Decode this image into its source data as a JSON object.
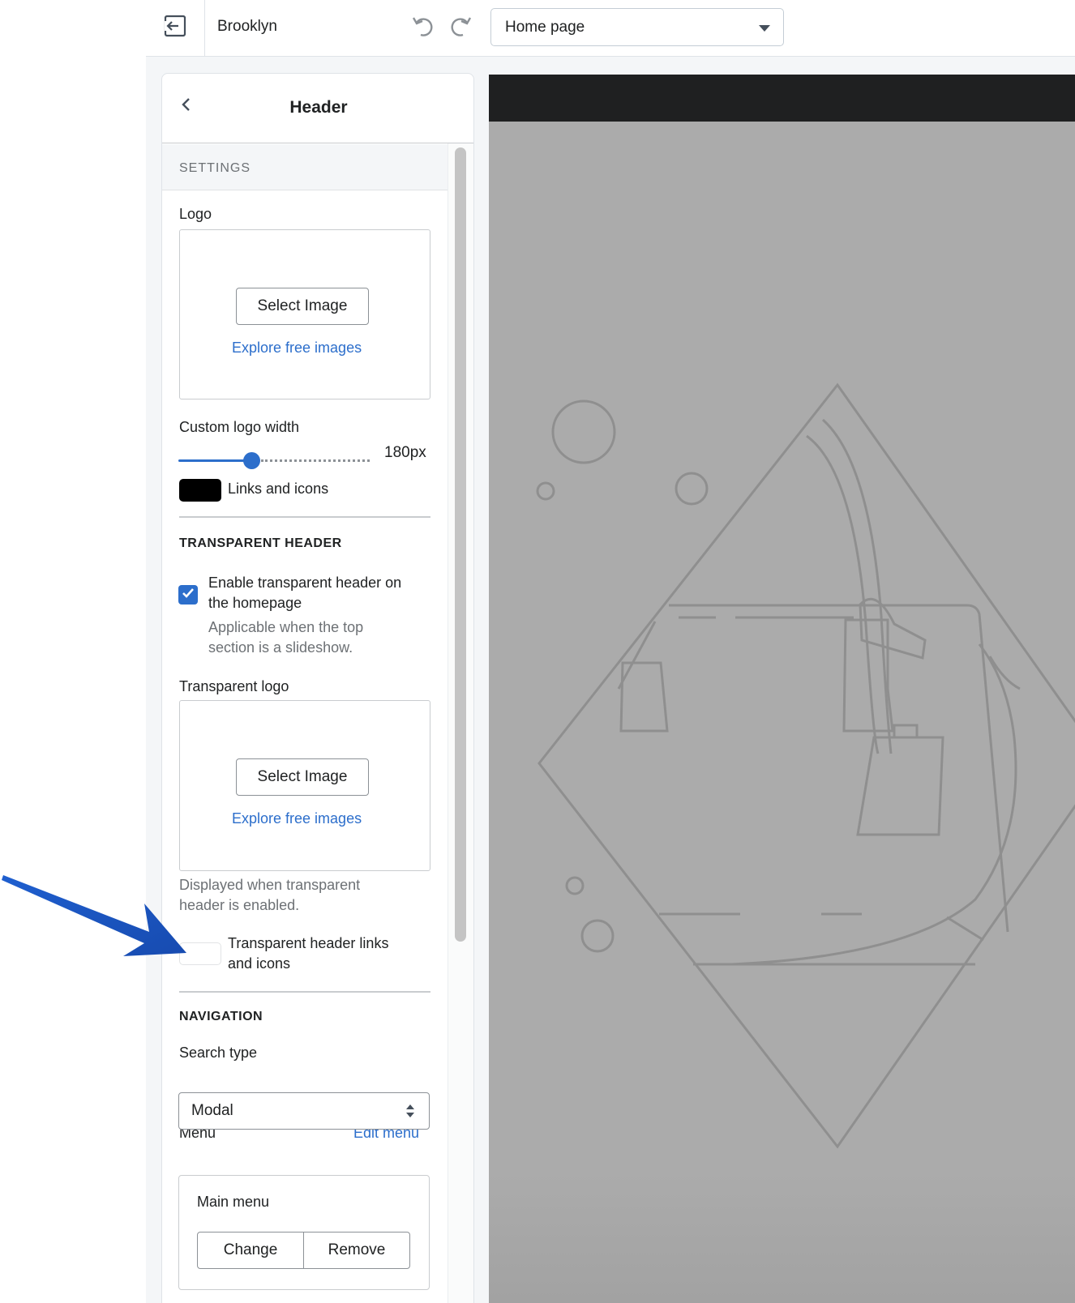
{
  "topbar": {
    "theme_name": "Brooklyn",
    "page_select_value": "Home page",
    "icons": [
      "exit-icon",
      "undo-icon",
      "redo-icon",
      "chevron-down-icon"
    ]
  },
  "panel": {
    "title": "Header",
    "settings_label": "SETTINGS",
    "logo": {
      "label": "Logo",
      "select_button": "Select Image",
      "explore_link": "Explore free images"
    },
    "logo_width": {
      "label": "Custom logo width",
      "value": "180px",
      "fill_fraction": 0.38
    },
    "links_color": {
      "label": "Links and icons",
      "color": "#000000"
    },
    "transparent_section": {
      "heading": "TRANSPARENT HEADER",
      "checkbox_label_1": "Enable transparent header on",
      "checkbox_label_2": "the homepage",
      "checkbox_checked": true,
      "help_1": "Applicable when the top",
      "help_2": "section is a slideshow.",
      "logo_label": "Transparent logo",
      "select_button": "Select Image",
      "explore_link": "Explore free images",
      "logo_help_1": "Displayed when transparent",
      "logo_help_2": "header is enabled.",
      "links_label_1": "Transparent header links",
      "links_label_2": "and icons",
      "links_color": "#ffffff"
    },
    "navigation": {
      "heading": "NAVIGATION",
      "search_type_label": "Search type",
      "search_type_value": "Modal",
      "menu_label": "Menu",
      "edit_menu_link": "Edit menu",
      "menu_name": "Main menu",
      "change_button": "Change",
      "remove_button": "Remove"
    }
  },
  "colors": {
    "accent": "#2c6ecb",
    "preview_bg": "#ababab",
    "preview_bar": "#1f2021",
    "annotation_arrow": "#1f5fcf"
  }
}
